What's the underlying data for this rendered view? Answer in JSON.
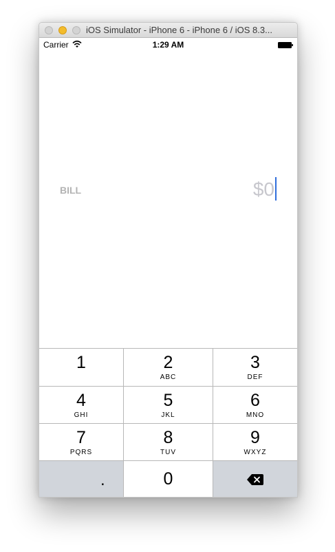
{
  "window": {
    "title": "iOS Simulator - iPhone 6 - iPhone 6 / iOS 8.3..."
  },
  "status_bar": {
    "carrier": "Carrier",
    "time": "1:29 AM",
    "icons": [
      "wifi-icon",
      "battery-icon"
    ]
  },
  "bill": {
    "label": "BILL",
    "placeholder": "$0",
    "value": ""
  },
  "keypad": {
    "keys": [
      {
        "digit": "1",
        "letters": ""
      },
      {
        "digit": "2",
        "letters": "ABC"
      },
      {
        "digit": "3",
        "letters": "DEF"
      },
      {
        "digit": "4",
        "letters": "GHI"
      },
      {
        "digit": "5",
        "letters": "JKL"
      },
      {
        "digit": "6",
        "letters": "MNO"
      },
      {
        "digit": "7",
        "letters": "PQRS"
      },
      {
        "digit": "8",
        "letters": "TUV"
      },
      {
        "digit": "9",
        "letters": "WXYZ"
      }
    ],
    "decimal": ".",
    "zero": "0",
    "delete_icon": "delete-backspace-icon"
  },
  "colors": {
    "cursor": "#2f6ddb",
    "minimize_light": "#f3bc2c",
    "placeholder": "#c7c7cd",
    "label": "#b3b3b3",
    "key_dark": "#d1d5db"
  }
}
